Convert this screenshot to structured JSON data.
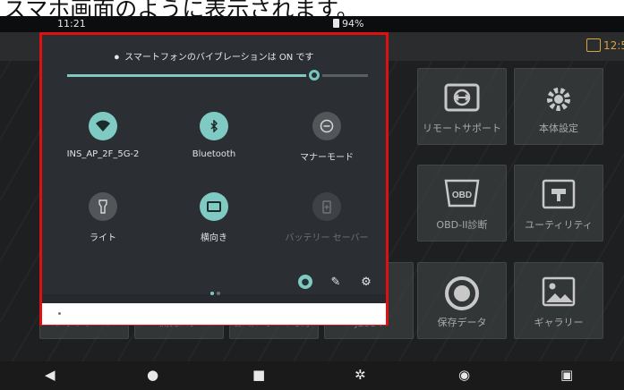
{
  "heading": "スマホ画面のように表示されます。",
  "status": {
    "time": "11:21",
    "battery": "94%"
  },
  "appbar": {
    "time": "12:5"
  },
  "tiles": [
    {
      "label": "リモートサポート",
      "icon": "remote-support-icon"
    },
    {
      "label": "本体設定",
      "icon": "settings-gear-icon"
    },
    {
      "label": "OBD-II診断",
      "icon": "obd-icon"
    },
    {
      "label": "ユーティリティ",
      "icon": "utility-icon"
    },
    {
      "label": "アップデート",
      "icon": ""
    },
    {
      "label": "開発ログ",
      "icon": ""
    },
    {
      "label": "診断レポート表示",
      "icon": ""
    },
    {
      "label": "J2534",
      "icon": ""
    },
    {
      "label": "保存データ",
      "icon": "saved-data-icon"
    },
    {
      "label": "ギャラリー",
      "icon": "gallery-icon"
    }
  ],
  "quick_settings": {
    "vibration_text": "スマートフォンのバイブレーションは ON です",
    "slider_value": 0.82,
    "tiles": [
      {
        "label": "INS_AP_2F_5G-2",
        "state": "on",
        "icon": "wifi-icon"
      },
      {
        "label": "Bluetooth",
        "state": "on",
        "icon": "bluetooth-icon"
      },
      {
        "label": "マナーモード",
        "state": "off",
        "icon": "do-not-disturb-icon"
      },
      {
        "label": "ライト",
        "state": "off",
        "icon": "flashlight-icon"
      },
      {
        "label": "横向き",
        "state": "on",
        "icon": "rotation-icon"
      },
      {
        "label": "バッテリー セーバー",
        "state": "disabled",
        "icon": "battery-saver-icon"
      }
    ],
    "page_dots": 2,
    "active_dot": 0
  },
  "colors": {
    "accent": "#7fcac3",
    "highlight_border": "#e01010",
    "appbar_accent": "#d6a53c"
  }
}
